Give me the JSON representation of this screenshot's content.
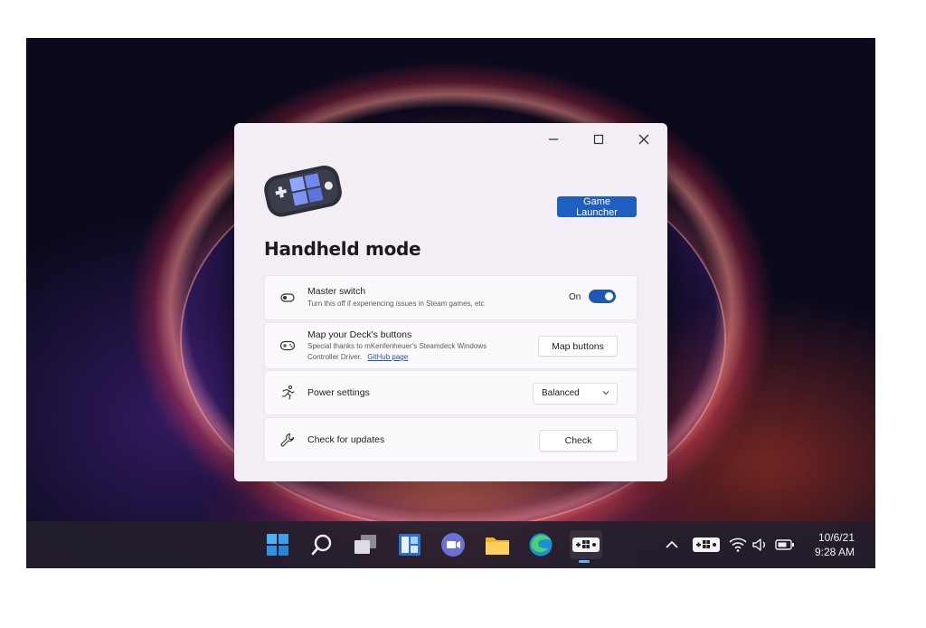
{
  "window": {
    "controls": {
      "minimize": "minimize",
      "maximize": "maximize",
      "close": "close"
    },
    "launcher_button": "Game Launcher",
    "title": "Handheld mode"
  },
  "settings": {
    "master": {
      "title": "Master switch",
      "desc": "Turn this off if experiencing issues in Steam games, etc",
      "toggle_label": "On",
      "toggle_on": true
    },
    "map": {
      "title": "Map your Deck's buttons",
      "desc": "Special thanks to mKenfenheuer's Steamdeck Windows Controller Driver.",
      "link": "GitHub page",
      "button": "Map buttons"
    },
    "power": {
      "title": "Power settings",
      "selected": "Balanced"
    },
    "updates": {
      "title": "Check for updates",
      "button": "Check"
    }
  },
  "taskbar": {
    "apps": [
      "windows-start",
      "search",
      "task-view",
      "widgets",
      "teams-chat",
      "file-explorer",
      "edge",
      "handheld-companion"
    ],
    "active_app": "handheld-companion",
    "date": "10/6/21",
    "time": "9:28 AM"
  },
  "colors": {
    "accent": "#1f5fbf",
    "toggle": "#2157b4",
    "taskbar": "#241e2c"
  }
}
